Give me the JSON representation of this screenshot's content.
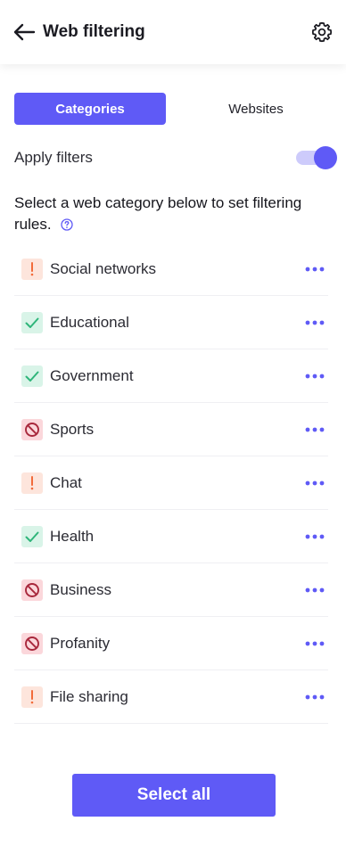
{
  "header": {
    "title": "Web filtering",
    "back_icon": "arrow-left-icon",
    "settings_icon": "gear-icon"
  },
  "tabs": [
    {
      "label": "Categories",
      "active": true
    },
    {
      "label": "Websites",
      "active": false
    }
  ],
  "apply_filters": {
    "label": "Apply filters",
    "enabled": true
  },
  "instructions": {
    "text": "Select a web category below to set filtering rules.",
    "help_icon": "question-circle-icon"
  },
  "categories": [
    {
      "label": "Social networks",
      "status": "warn"
    },
    {
      "label": "Educational",
      "status": "allow"
    },
    {
      "label": "Government",
      "status": "allow"
    },
    {
      "label": "Sports",
      "status": "block"
    },
    {
      "label": "Chat",
      "status": "warn"
    },
    {
      "label": "Health",
      "status": "allow"
    },
    {
      "label": "Business",
      "status": "block"
    },
    {
      "label": "Profanity",
      "status": "block"
    },
    {
      "label": "File sharing",
      "status": "warn"
    }
  ],
  "status_icons": {
    "warn": "exclamation-icon",
    "allow": "checkmark-icon",
    "block": "prohibited-icon"
  },
  "more_icon": "more-dots-icon",
  "footer": {
    "select_all_label": "Select all"
  },
  "colors": {
    "accent": "#5f5af6",
    "accent_light": "#cdcbfb",
    "warn_bg": "#fde5dc",
    "warn_fg": "#f26b3a",
    "allow_bg": "#d9f4e8",
    "allow_fg": "#2fb57a",
    "block_bg": "#fbd7db",
    "block_fg": "#a8283c"
  }
}
